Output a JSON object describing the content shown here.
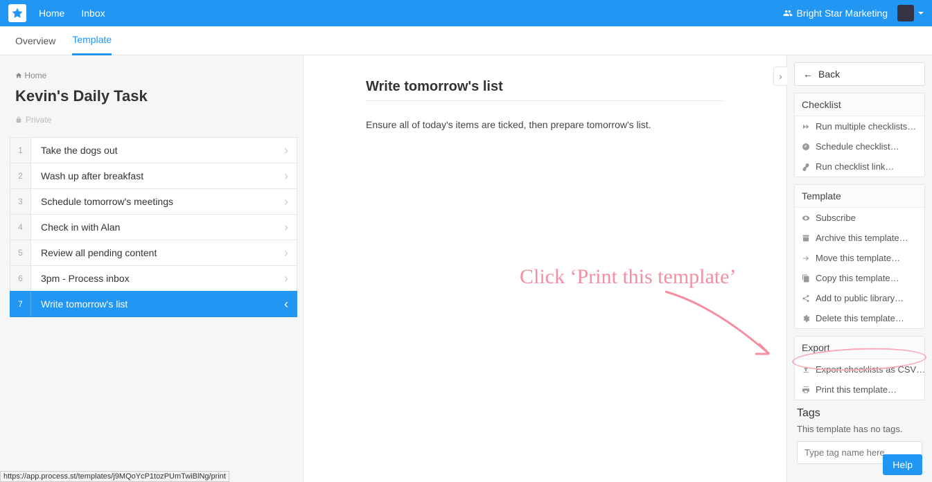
{
  "topnav": {
    "home": "Home",
    "inbox": "Inbox",
    "org_name": "Bright Star Marketing"
  },
  "subtabs": {
    "overview": "Overview",
    "template": "Template"
  },
  "breadcrumb": {
    "home": "Home"
  },
  "page_title": "Kevin's Daily Task",
  "privacy": "Private",
  "tasks": [
    {
      "n": "1",
      "label": "Take the dogs out"
    },
    {
      "n": "2",
      "label": "Wash up after breakfast"
    },
    {
      "n": "3",
      "label": "Schedule tomorrow's meetings"
    },
    {
      "n": "4",
      "label": "Check in with Alan"
    },
    {
      "n": "5",
      "label": "Review all pending content"
    },
    {
      "n": "6",
      "label": "3pm - Process inbox"
    },
    {
      "n": "7",
      "label": "Write tomorrow's list"
    }
  ],
  "detail": {
    "title": "Write tomorrow's list",
    "body": "Ensure all of today's items are ticked, then prepare tomorrow's list."
  },
  "right": {
    "back": "Back",
    "checklist_head": "Checklist",
    "checklist_items": {
      "run_multi": "Run multiple checklists…",
      "schedule": "Schedule checklist…",
      "run_link": "Run checklist link…"
    },
    "template_head": "Template",
    "template_items": {
      "subscribe": "Subscribe",
      "archive": "Archive this template…",
      "move": "Move this template…",
      "copy": "Copy this template…",
      "add_public": "Add to public library…",
      "delete": "Delete this template…"
    },
    "export_head": "Export",
    "export_items": {
      "csv": "Export checklists as CSV…",
      "print": "Print this template…"
    },
    "tags_head": "Tags",
    "tags_desc": "This template has no tags.",
    "tags_placeholder": "Type tag name here"
  },
  "help_label": "Help",
  "annotation_text": "Click ‘Print this template’",
  "status_url": "https://app.process.st/templates/j9MQoYcP1tozPUmTwiBlNg/print"
}
